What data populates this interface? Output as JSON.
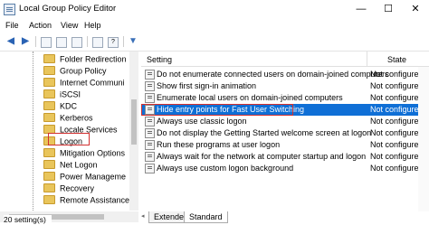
{
  "window": {
    "title": "Local Group Policy Editor",
    "controls": [
      "—",
      "☐",
      "✕"
    ]
  },
  "menu": [
    "File",
    "Action",
    "View",
    "Help"
  ],
  "toolbar": [
    "back-arrow",
    "forward-arrow",
    "console-tree",
    "window",
    "properties",
    "export",
    "help",
    "filter"
  ],
  "tree": {
    "items": [
      "Folder Redirection",
      "Group Policy",
      "Internet Communi",
      "iSCSI",
      "KDC",
      "Kerberos",
      "Locale Services",
      "Logon",
      "Mitigation Options",
      "Net Logon",
      "Power Manageme",
      "Recovery",
      "Remote Assistance"
    ],
    "selected": "Logon"
  },
  "list": {
    "columns": [
      "Setting",
      "State"
    ],
    "rows": [
      {
        "name": "Do not enumerate connected users on domain-joined computers",
        "state": "Not configure"
      },
      {
        "name": "Show first sign-in animation",
        "state": "Not configure"
      },
      {
        "name": "Enumerate local users on domain-joined computers",
        "state": "Not configure"
      },
      {
        "name": "Hide entry points for Fast User Switching",
        "state": "Not configure"
      },
      {
        "name": "Always use classic logon",
        "state": "Not configure"
      },
      {
        "name": "Do not display the Getting Started welcome screen at logon",
        "state": "Not configure"
      },
      {
        "name": "Run these programs at user logon",
        "state": "Not configure"
      },
      {
        "name": "Always wait for the network at computer startup and logon",
        "state": "Not configure"
      },
      {
        "name": "Always use custom logon background",
        "state": "Not configure"
      }
    ],
    "selected_row": "Hide entry points for Fast User Switching"
  },
  "tabs": [
    "Extended",
    "Standard"
  ],
  "active_tab": "Standard",
  "status": "20 setting(s)",
  "colors": {
    "selection": "#0f6fd6",
    "highlight_box": "#d23030",
    "folder": "#e9c55b"
  }
}
